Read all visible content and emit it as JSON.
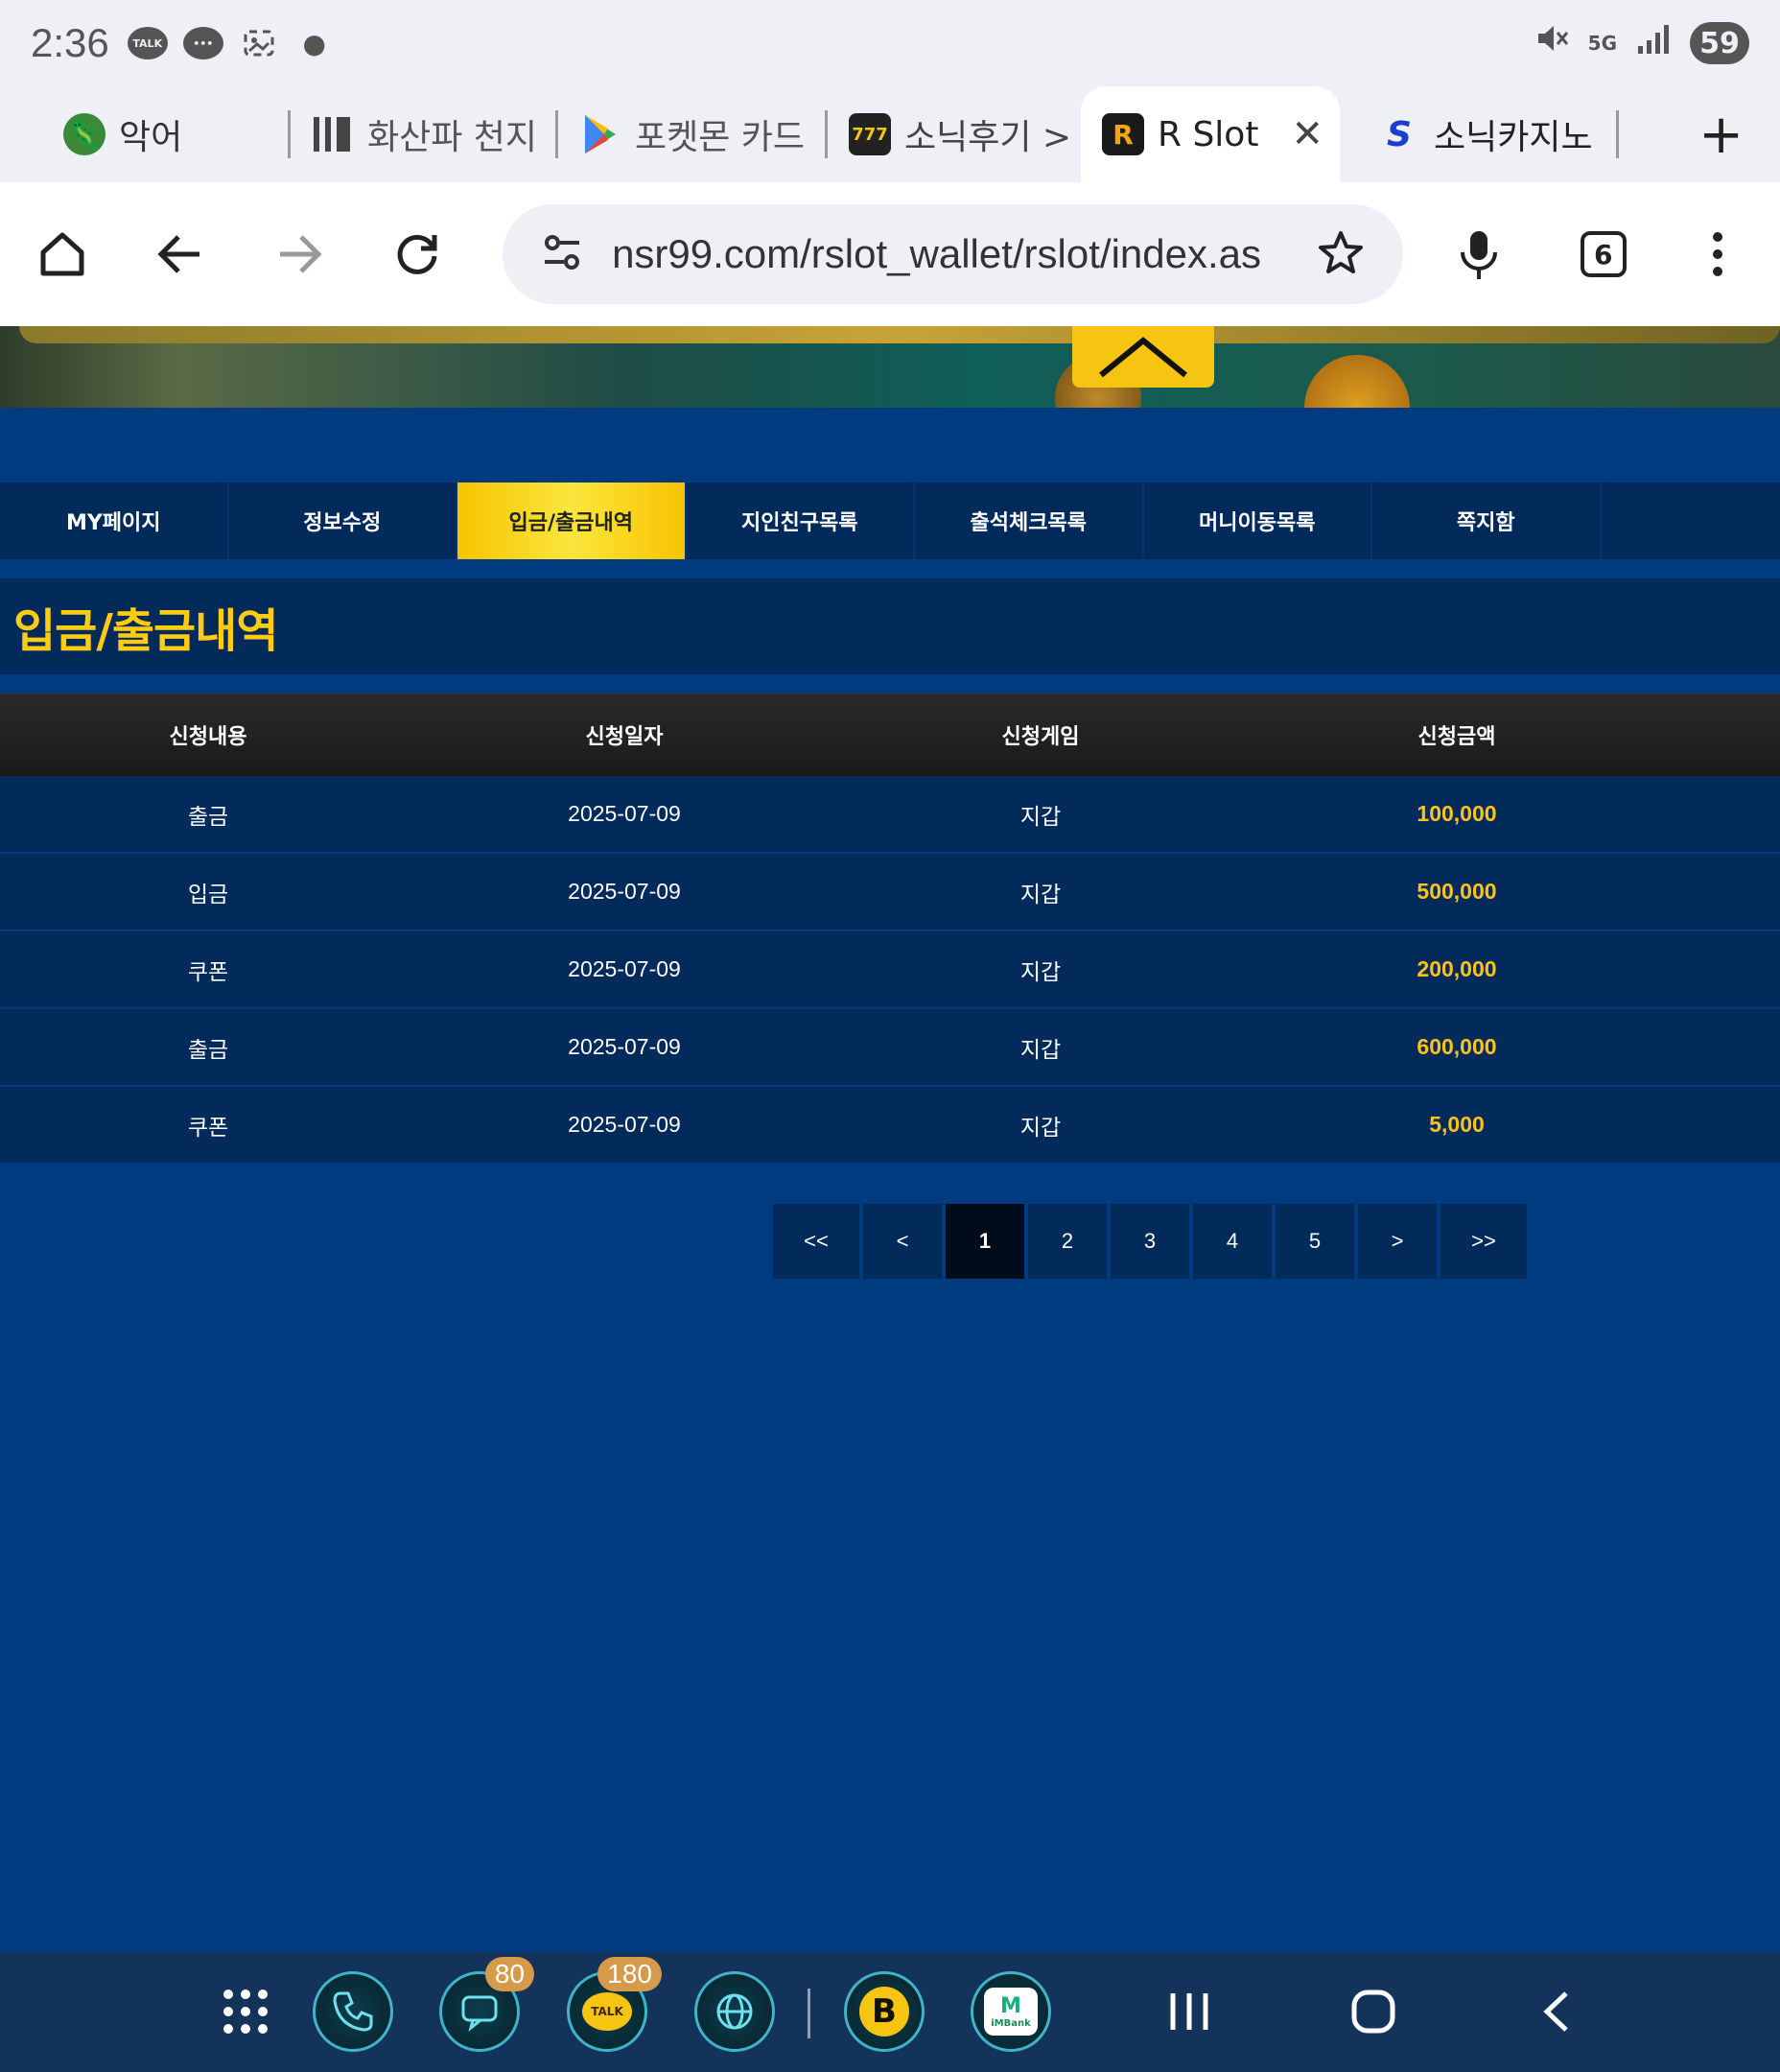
{
  "status_bar": {
    "time": "2:36",
    "battery": "59",
    "network": "5G"
  },
  "browser": {
    "tabs": [
      {
        "title": "악어",
        "icon": "gecko-icon"
      },
      {
        "title": "화산파 천지",
        "icon": "barcode-icon"
      },
      {
        "title": "포켓몬 카드",
        "icon": "play-store-icon"
      },
      {
        "title": "소닉후기 >",
        "icon": "slot-icon"
      },
      {
        "title": "R Slot",
        "icon": "r-slot-icon"
      },
      {
        "title": "소닉카지노",
        "icon": "s-logo-icon"
      }
    ],
    "active_tab_index": 4,
    "url": "nsr99.com/rslot_wallet/rslot/index.as",
    "tab_count": "6"
  },
  "site": {
    "menu": [
      {
        "label": "MY페이지"
      },
      {
        "label": "정보수정"
      },
      {
        "label": "입금/출금내역"
      },
      {
        "label": "지인친구목록"
      },
      {
        "label": "출석체크목록"
      },
      {
        "label": "머니이동목록"
      },
      {
        "label": "쪽지함"
      }
    ],
    "active_menu_index": 2,
    "page_title": "입금/출금내역",
    "table": {
      "headers": [
        "신청내용",
        "신청일자",
        "신청게임",
        "신청금액"
      ],
      "rows": [
        [
          "출금",
          "2025-07-09",
          "지갑",
          "100,000"
        ],
        [
          "입금",
          "2025-07-09",
          "지갑",
          "500,000"
        ],
        [
          "쿠폰",
          "2025-07-09",
          "지갑",
          "200,000"
        ],
        [
          "출금",
          "2025-07-09",
          "지갑",
          "600,000"
        ],
        [
          "쿠폰",
          "2025-07-09",
          "지갑",
          "5,000"
        ]
      ]
    },
    "pagination": {
      "first": "<<",
      "prev": "<",
      "pages": [
        "1",
        "2",
        "3",
        "4",
        "5"
      ],
      "current": "1",
      "next": ">",
      "last": ">>"
    }
  },
  "dock": {
    "messages_badge": "80",
    "talk_badge": "180",
    "talk_label": "TALK",
    "bank_label": "iMBank",
    "b_label": "B"
  },
  "colors": {
    "page_bg": "#013b7f",
    "panel_bg": "#022a5a",
    "accent_yellow": "#ffcc11",
    "amount_color": "#ffc21a"
  }
}
